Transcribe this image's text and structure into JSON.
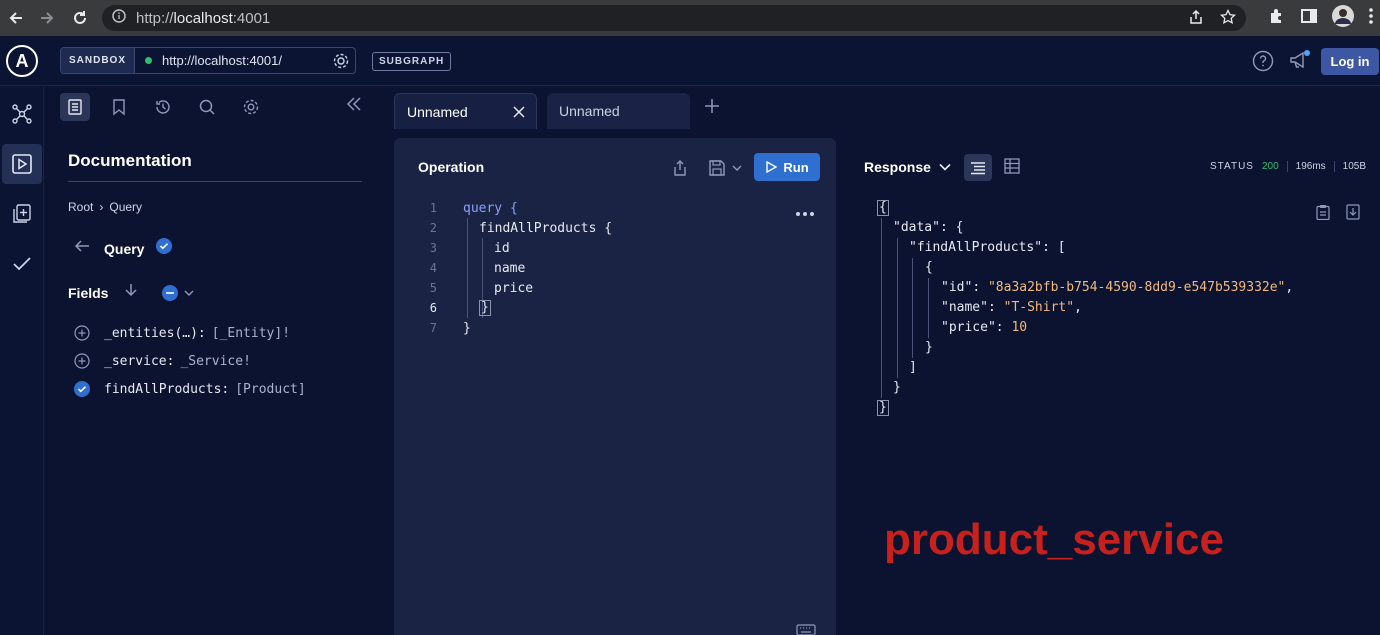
{
  "browser": {
    "url_prefix": "http://",
    "url_host": "localhost",
    "url_port": ":4001"
  },
  "header": {
    "sandbox_label": "SANDBOX",
    "endpoint": "http://localhost:4001/",
    "subgraph_label": "SUBGRAPH",
    "login_label": "Log in"
  },
  "docs": {
    "title": "Documentation",
    "breadcrumb_root": "Root",
    "breadcrumb_sep": "›",
    "breadcrumb_current": "Query",
    "query_title": "Query",
    "fields_label": "Fields",
    "fields": [
      {
        "name": "_entities(…):",
        "type": "[_Entity]!",
        "selected": false
      },
      {
        "name": "_service:",
        "type": "_Service!",
        "selected": false
      },
      {
        "name": "findAllProducts:",
        "type": "[Product]",
        "selected": true
      }
    ]
  },
  "tabs": [
    {
      "label": "Unnamed",
      "active": true
    },
    {
      "label": "Unnamed",
      "active": false
    }
  ],
  "operation": {
    "title": "Operation",
    "run_label": "Run",
    "lines": [
      {
        "n": "1",
        "text": "query {"
      },
      {
        "n": "2",
        "text": "findAllProducts {"
      },
      {
        "n": "3",
        "text": "id"
      },
      {
        "n": "4",
        "text": "name"
      },
      {
        "n": "5",
        "text": "price"
      },
      {
        "n": "6",
        "text": "}"
      },
      {
        "n": "7",
        "text": "}"
      }
    ]
  },
  "response": {
    "title": "Response",
    "status_label": "STATUS",
    "status_code": "200",
    "time": "196ms",
    "size": "105B",
    "json": {
      "data_key": "\"data\"",
      "list_key": "\"findAllProducts\"",
      "id_key": "\"id\"",
      "id_value": "\"8a3a2bfb-b754-4590-8dd9-e547b539332e\"",
      "name_key": "\"name\"",
      "name_value": "\"T-Shirt\"",
      "price_key": "\"price\"",
      "price_value": "10"
    }
  },
  "annotation": "product_service",
  "colors": {
    "accent": "#2e6fd0",
    "status_ok": "#2fbf71",
    "annotation": "#c7201d",
    "background": "#0b1330"
  },
  "icons": [
    "back-arrow-icon",
    "forward-arrow-icon",
    "reload-icon",
    "info-icon",
    "share-icon",
    "star-icon",
    "extensions-icon",
    "sidebar-icon",
    "avatar",
    "kebab-icon",
    "apollo-logo",
    "gear-icon",
    "help-icon",
    "announcement-icon",
    "graph-icon",
    "play-icon",
    "collection-icon",
    "check-icon",
    "doc-icon",
    "bookmark-icon",
    "history-icon",
    "search-icon",
    "collapse-icon",
    "close-icon",
    "plus-icon",
    "save-icon",
    "keyboard-icon",
    "clipboard-icon",
    "download-icon"
  ]
}
